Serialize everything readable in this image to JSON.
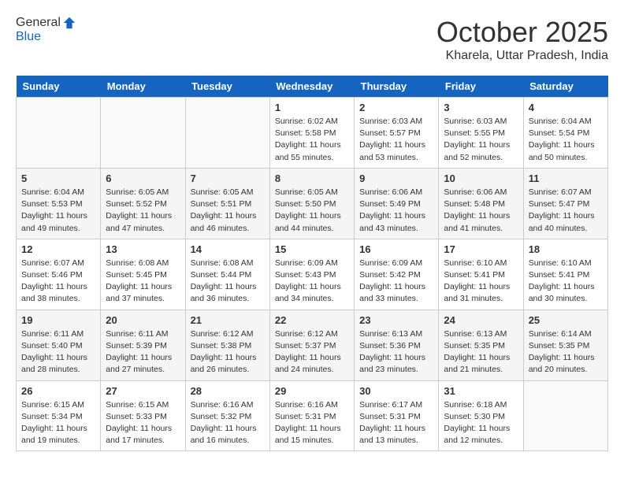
{
  "header": {
    "logo_line1": "General",
    "logo_line2": "Blue",
    "month": "October 2025",
    "location": "Kharela, Uttar Pradesh, India"
  },
  "weekdays": [
    "Sunday",
    "Monday",
    "Tuesday",
    "Wednesday",
    "Thursday",
    "Friday",
    "Saturday"
  ],
  "weeks": [
    [
      {
        "day": "",
        "info": ""
      },
      {
        "day": "",
        "info": ""
      },
      {
        "day": "",
        "info": ""
      },
      {
        "day": "1",
        "info": "Sunrise: 6:02 AM\nSunset: 5:58 PM\nDaylight: 11 hours\nand 55 minutes."
      },
      {
        "day": "2",
        "info": "Sunrise: 6:03 AM\nSunset: 5:57 PM\nDaylight: 11 hours\nand 53 minutes."
      },
      {
        "day": "3",
        "info": "Sunrise: 6:03 AM\nSunset: 5:55 PM\nDaylight: 11 hours\nand 52 minutes."
      },
      {
        "day": "4",
        "info": "Sunrise: 6:04 AM\nSunset: 5:54 PM\nDaylight: 11 hours\nand 50 minutes."
      }
    ],
    [
      {
        "day": "5",
        "info": "Sunrise: 6:04 AM\nSunset: 5:53 PM\nDaylight: 11 hours\nand 49 minutes."
      },
      {
        "day": "6",
        "info": "Sunrise: 6:05 AM\nSunset: 5:52 PM\nDaylight: 11 hours\nand 47 minutes."
      },
      {
        "day": "7",
        "info": "Sunrise: 6:05 AM\nSunset: 5:51 PM\nDaylight: 11 hours\nand 46 minutes."
      },
      {
        "day": "8",
        "info": "Sunrise: 6:05 AM\nSunset: 5:50 PM\nDaylight: 11 hours\nand 44 minutes."
      },
      {
        "day": "9",
        "info": "Sunrise: 6:06 AM\nSunset: 5:49 PM\nDaylight: 11 hours\nand 43 minutes."
      },
      {
        "day": "10",
        "info": "Sunrise: 6:06 AM\nSunset: 5:48 PM\nDaylight: 11 hours\nand 41 minutes."
      },
      {
        "day": "11",
        "info": "Sunrise: 6:07 AM\nSunset: 5:47 PM\nDaylight: 11 hours\nand 40 minutes."
      }
    ],
    [
      {
        "day": "12",
        "info": "Sunrise: 6:07 AM\nSunset: 5:46 PM\nDaylight: 11 hours\nand 38 minutes."
      },
      {
        "day": "13",
        "info": "Sunrise: 6:08 AM\nSunset: 5:45 PM\nDaylight: 11 hours\nand 37 minutes."
      },
      {
        "day": "14",
        "info": "Sunrise: 6:08 AM\nSunset: 5:44 PM\nDaylight: 11 hours\nand 36 minutes."
      },
      {
        "day": "15",
        "info": "Sunrise: 6:09 AM\nSunset: 5:43 PM\nDaylight: 11 hours\nand 34 minutes."
      },
      {
        "day": "16",
        "info": "Sunrise: 6:09 AM\nSunset: 5:42 PM\nDaylight: 11 hours\nand 33 minutes."
      },
      {
        "day": "17",
        "info": "Sunrise: 6:10 AM\nSunset: 5:41 PM\nDaylight: 11 hours\nand 31 minutes."
      },
      {
        "day": "18",
        "info": "Sunrise: 6:10 AM\nSunset: 5:41 PM\nDaylight: 11 hours\nand 30 minutes."
      }
    ],
    [
      {
        "day": "19",
        "info": "Sunrise: 6:11 AM\nSunset: 5:40 PM\nDaylight: 11 hours\nand 28 minutes."
      },
      {
        "day": "20",
        "info": "Sunrise: 6:11 AM\nSunset: 5:39 PM\nDaylight: 11 hours\nand 27 minutes."
      },
      {
        "day": "21",
        "info": "Sunrise: 6:12 AM\nSunset: 5:38 PM\nDaylight: 11 hours\nand 26 minutes."
      },
      {
        "day": "22",
        "info": "Sunrise: 6:12 AM\nSunset: 5:37 PM\nDaylight: 11 hours\nand 24 minutes."
      },
      {
        "day": "23",
        "info": "Sunrise: 6:13 AM\nSunset: 5:36 PM\nDaylight: 11 hours\nand 23 minutes."
      },
      {
        "day": "24",
        "info": "Sunrise: 6:13 AM\nSunset: 5:35 PM\nDaylight: 11 hours\nand 21 minutes."
      },
      {
        "day": "25",
        "info": "Sunrise: 6:14 AM\nSunset: 5:35 PM\nDaylight: 11 hours\nand 20 minutes."
      }
    ],
    [
      {
        "day": "26",
        "info": "Sunrise: 6:15 AM\nSunset: 5:34 PM\nDaylight: 11 hours\nand 19 minutes."
      },
      {
        "day": "27",
        "info": "Sunrise: 6:15 AM\nSunset: 5:33 PM\nDaylight: 11 hours\nand 17 minutes."
      },
      {
        "day": "28",
        "info": "Sunrise: 6:16 AM\nSunset: 5:32 PM\nDaylight: 11 hours\nand 16 minutes."
      },
      {
        "day": "29",
        "info": "Sunrise: 6:16 AM\nSunset: 5:31 PM\nDaylight: 11 hours\nand 15 minutes."
      },
      {
        "day": "30",
        "info": "Sunrise: 6:17 AM\nSunset: 5:31 PM\nDaylight: 11 hours\nand 13 minutes."
      },
      {
        "day": "31",
        "info": "Sunrise: 6:18 AM\nSunset: 5:30 PM\nDaylight: 11 hours\nand 12 minutes."
      },
      {
        "day": "",
        "info": ""
      }
    ]
  ]
}
